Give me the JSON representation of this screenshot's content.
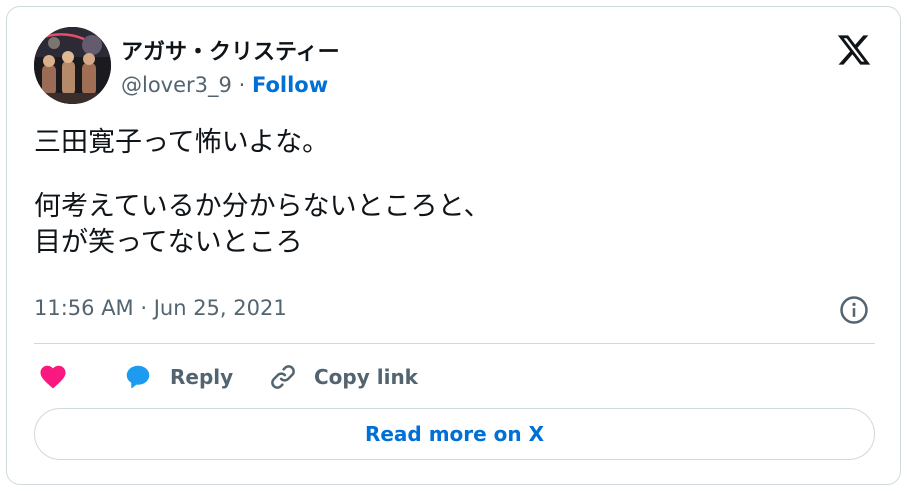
{
  "user": {
    "display_name": "アガサ・クリスティー",
    "handle": "@lover3_9",
    "separator": "·",
    "follow_label": "Follow"
  },
  "tweet": {
    "lines": [
      "三田寛子って怖いよな。",
      "",
      "何考えているか分からないところと、",
      "目が笑ってないところ"
    ],
    "timestamp": "11:56 AM · Jun 25, 2021"
  },
  "actions": {
    "like_icon": "heart-icon",
    "reply_label": "Reply",
    "copy_link_label": "Copy link"
  },
  "read_more_label": "Read more on X",
  "colors": {
    "accent": "#006fd6",
    "like": "#f91880",
    "reply_bubble": "#1d9bf0",
    "text": "#0f1419",
    "secondary": "#536471",
    "border": "#cfd9de"
  }
}
